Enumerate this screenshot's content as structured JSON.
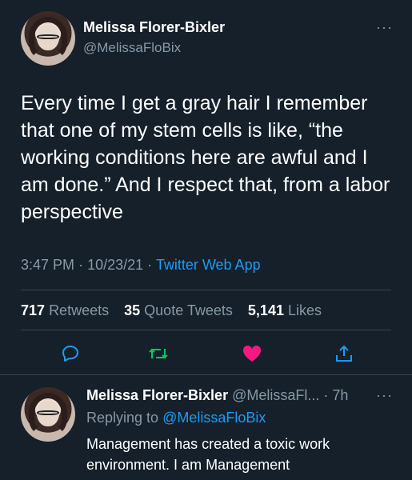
{
  "tweet": {
    "author_name": "Melissa Florer-Bixler",
    "author_handle": "@MelissaFloBix",
    "more_label": "···",
    "text": "Every time I get a gray hair I remember that one of my stem cells is like, “the working conditions here are awful and I am done.” And I respect that, from a labor perspective",
    "time": "3:47 PM",
    "date": "10/23/21",
    "separator": "·",
    "source_app": "Twitter Web App",
    "retweets_count": "717",
    "retweets_label": "Retweets",
    "quote_count": "35",
    "quote_label": "Quote Tweets",
    "likes_count": "5,141",
    "likes_label": "Likes"
  },
  "actions": {
    "icons": [
      "reply-icon",
      "retweet-icon",
      "like-icon-filled",
      "share-icon"
    ],
    "colors": {
      "reply": "#1d9bf0",
      "retweet": "#17bf63",
      "like": "#f91880",
      "share": "#1d9bf0"
    }
  },
  "reply": {
    "author_name": "Melissa Florer-Bixler",
    "author_handle": "@MelissaFl...",
    "separator": "·",
    "time_ago": "7h",
    "more_label": "···",
    "replying_prefix": "Replying to",
    "replying_to": "@MelissaFloBix",
    "text": "Management has created a toxic work environment. I am Management"
  },
  "colors": {
    "background": "#15202b",
    "muted": "#8899a6",
    "accent": "#1d9bf0",
    "divider": "#38444d"
  }
}
